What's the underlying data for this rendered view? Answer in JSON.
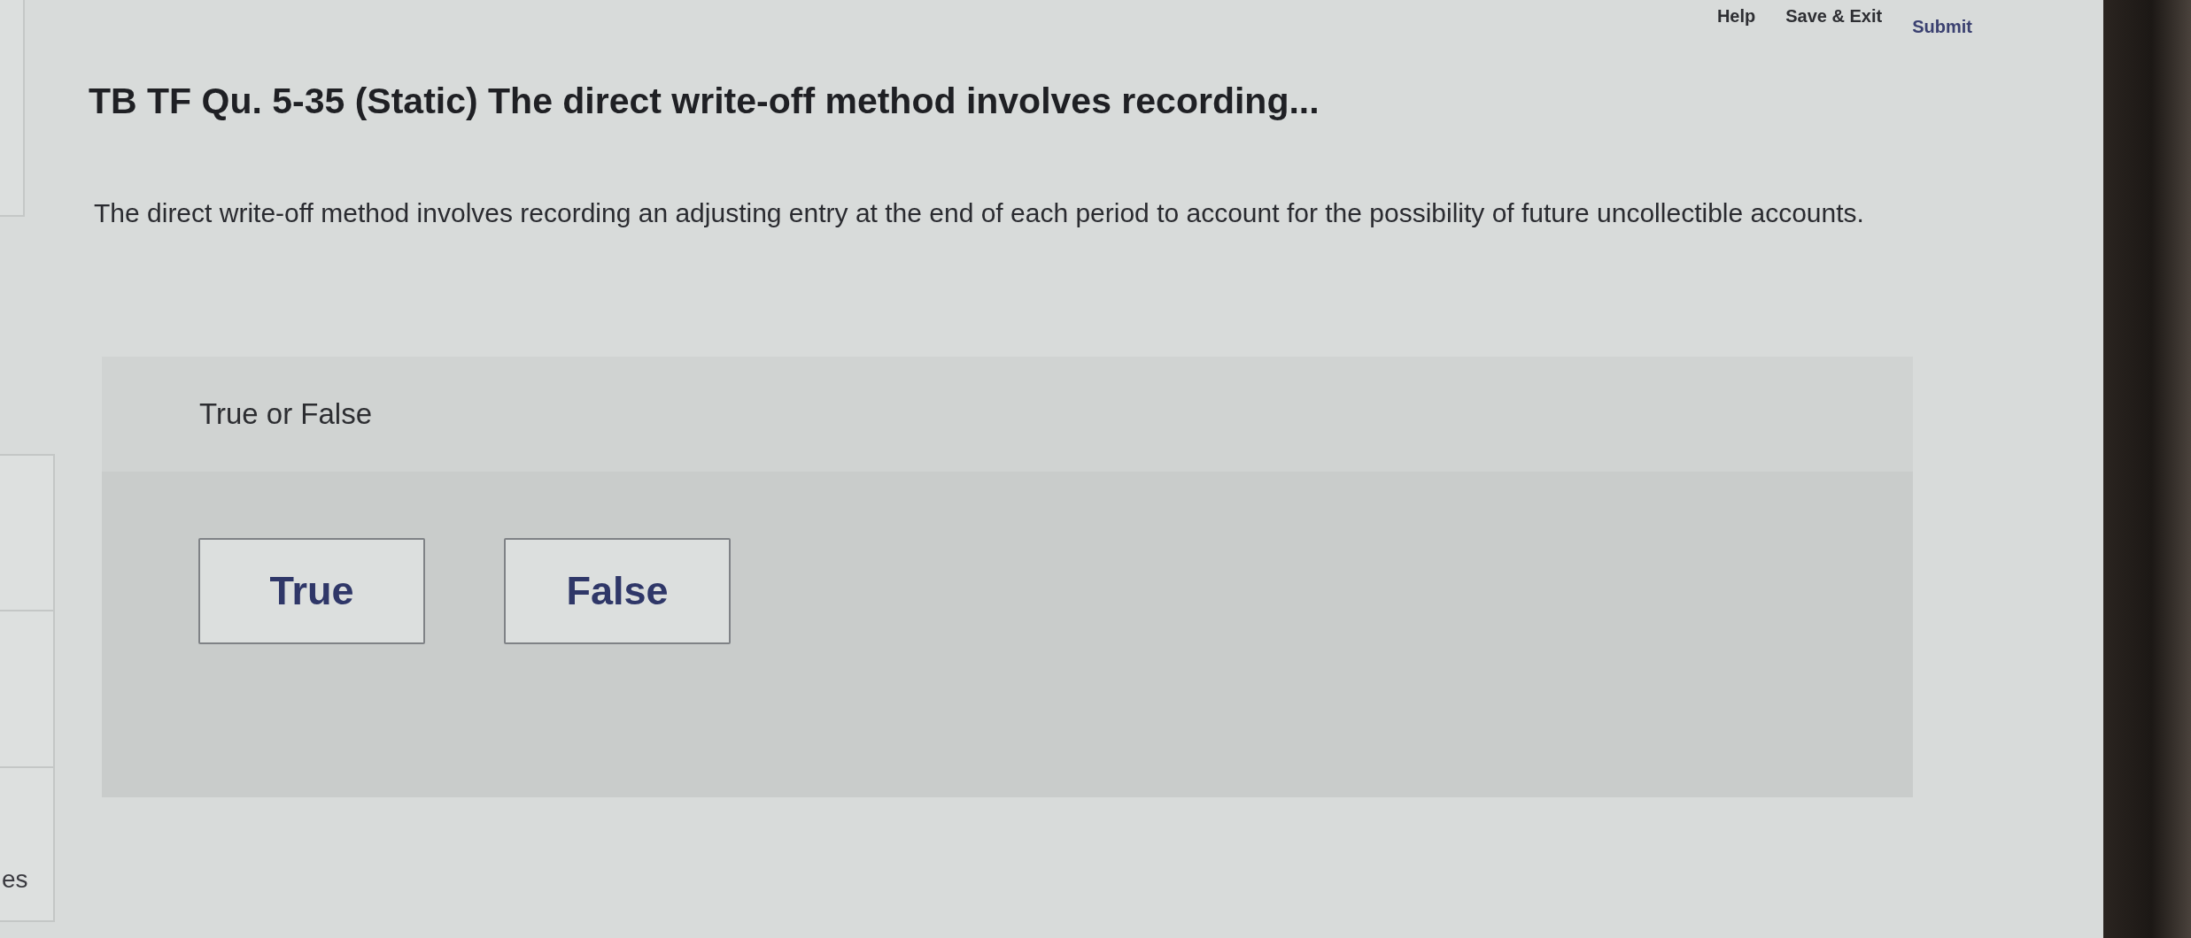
{
  "header_links": [
    {
      "label": "Help",
      "kind": "link"
    },
    {
      "label": "Save & Exit",
      "kind": "link"
    },
    {
      "label": "Submit",
      "kind": "primary"
    }
  ],
  "question": {
    "title": "TB TF Qu. 5-35 (Static) The direct write-off method involves recording...",
    "prompt": "The direct write-off method involves recording an adjusting entry at the end of each period to account for the possibility of future uncollectible accounts."
  },
  "answer_panel": {
    "heading": "True or False",
    "options": [
      {
        "label": "True",
        "selected": false
      },
      {
        "label": "False",
        "selected": false
      }
    ]
  },
  "sidebar": {
    "label": "es"
  }
}
